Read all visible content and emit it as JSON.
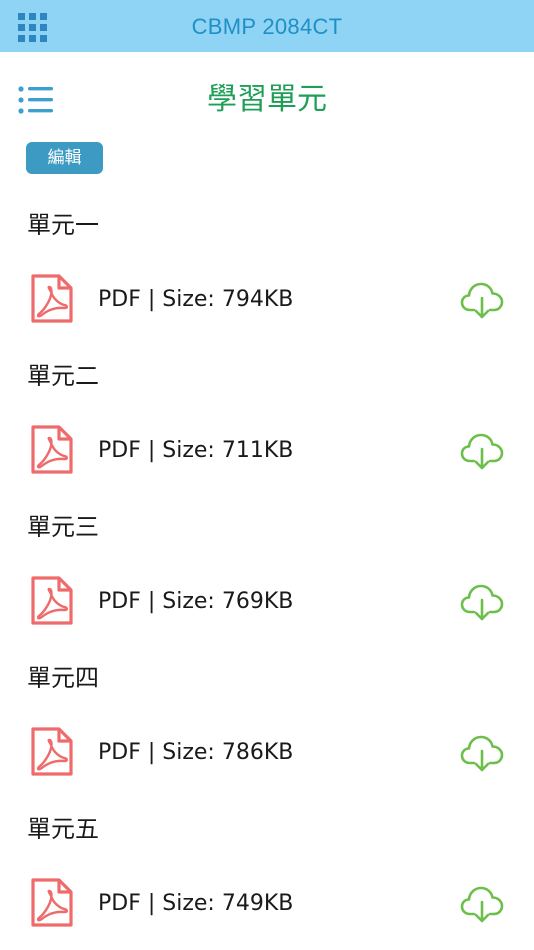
{
  "topbar": {
    "title": "CBMP 2084CT",
    "grid_icon": "grid-icon",
    "background_color": "#8fd4f4",
    "title_color": "#1f8fc8"
  },
  "header": {
    "title": "學習單元",
    "menu_icon": "list-menu-icon",
    "title_color": "#1f9e57"
  },
  "edit_button": {
    "label": "編輯",
    "color": "#3c9ac3"
  },
  "units": [
    {
      "title": "單元一",
      "file": {
        "info": "PDF | Size: 794KB",
        "type_icon": "pdf-icon",
        "action_icon": "cloud-download-icon"
      }
    },
    {
      "title": "單元二",
      "file": {
        "info": "PDF | Size: 711KB",
        "type_icon": "pdf-icon",
        "action_icon": "cloud-download-icon"
      }
    },
    {
      "title": "單元三",
      "file": {
        "info": "PDF | Size: 769KB",
        "type_icon": "pdf-icon",
        "action_icon": "cloud-download-icon"
      }
    },
    {
      "title": "單元四",
      "file": {
        "info": "PDF | Size: 786KB",
        "type_icon": "pdf-icon",
        "action_icon": "cloud-download-icon"
      }
    },
    {
      "title": "單元五",
      "file": {
        "info": "PDF | Size: 749KB",
        "type_icon": "pdf-icon",
        "action_icon": "cloud-download-icon"
      }
    }
  ],
  "colors": {
    "pdf_icon": "#ef6b6b",
    "download_icon": "#6cbf4a"
  }
}
